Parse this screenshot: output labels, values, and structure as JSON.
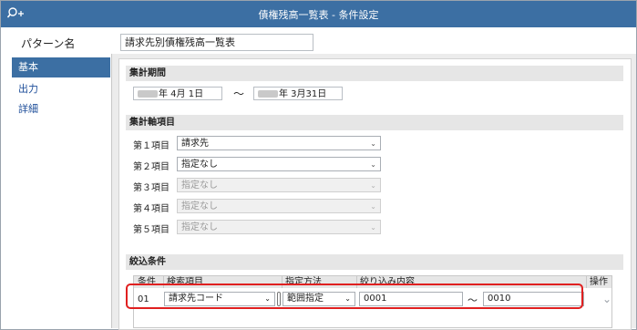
{
  "titlebar": {
    "title": "債権残高一覧表 - 条件設定",
    "icon": "search-plus-icon"
  },
  "pattern": {
    "label": "パターン名",
    "value": "請求先別債権残高一覧表"
  },
  "sidebar": {
    "items": [
      {
        "label": "基本",
        "active": true
      },
      {
        "label": "出力"
      },
      {
        "label": "詳細"
      }
    ]
  },
  "period": {
    "heading": "集計期間",
    "from": {
      "suffix": "年  4月  1日"
    },
    "tilde": "～",
    "to": {
      "suffix": "年  3月31日"
    }
  },
  "axes": {
    "heading": "集計軸項目",
    "rows": [
      {
        "label": "第１項目",
        "value": "請求先",
        "disabled": false
      },
      {
        "label": "第２項目",
        "value": "指定なし",
        "disabled": false
      },
      {
        "label": "第３項目",
        "value": "指定なし",
        "disabled": true
      },
      {
        "label": "第４項目",
        "value": "指定なし",
        "disabled": true
      },
      {
        "label": "第５項目",
        "value": "指定なし",
        "disabled": true
      }
    ]
  },
  "filter": {
    "heading": "絞込条件",
    "columns": {
      "no": "条件",
      "item": "検索項目",
      "method": "指定方法",
      "content": "絞り込み内容",
      "op": "操作"
    },
    "rows": [
      {
        "no": "01",
        "item": "請求先コード",
        "method": "範囲指定",
        "from": "0001",
        "tilde": "～",
        "to": "0010"
      }
    ]
  },
  "colors": {
    "titlebar": "#3c6fa3",
    "highlight": "#e02020",
    "accent_text": "#1f4f9a"
  }
}
